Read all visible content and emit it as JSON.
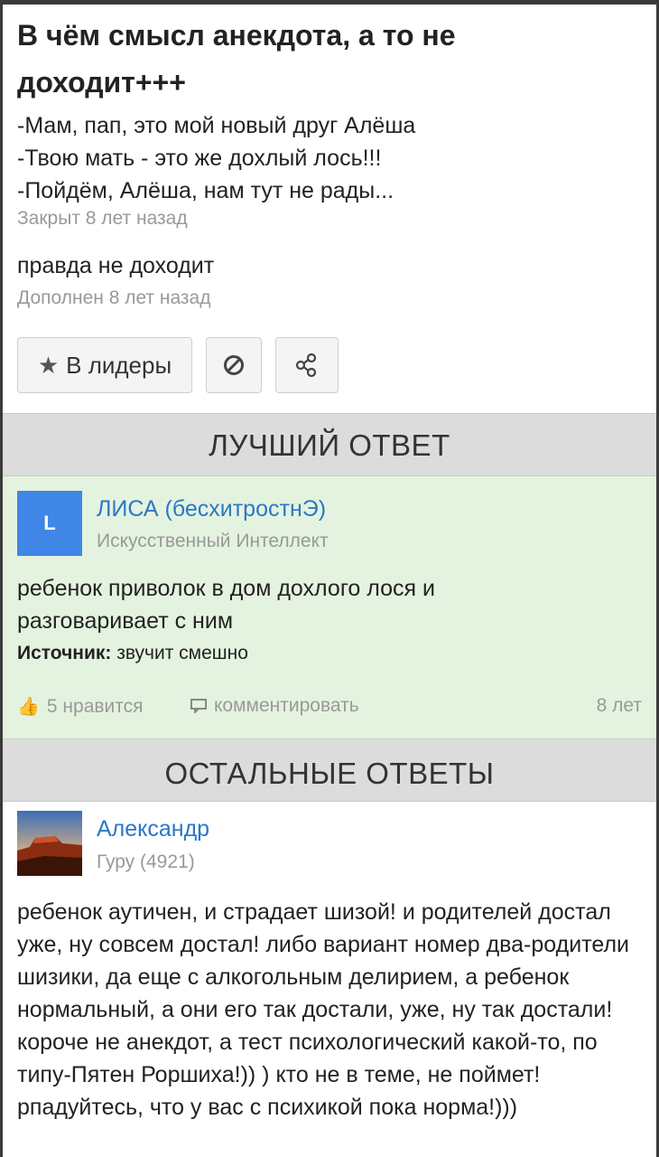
{
  "question": {
    "title": "В чём смысл анекдота, а то не доходит+++",
    "lines": [
      "-Мам, пап, это мой новый друг Алёша",
      "-Твою мать - это же дохлый лось!!!",
      "-Пойдём, Алёша, нам тут не рады..."
    ],
    "closed": "Закрыт 8 лет назад",
    "addendum": "правда не доходит",
    "added": "Дополнен 8 лет назад"
  },
  "buttons": {
    "leaders": "В лидеры",
    "leaders_icon": "star-icon",
    "report_icon": "block-icon",
    "share_icon": "share-icon"
  },
  "sections": {
    "best": "ЛУЧШИЙ ОТВЕТ",
    "other": "ОСТАЛЬНЫЕ ОТВЕТЫ"
  },
  "best_answer": {
    "avatar_letter": "L",
    "author": "ЛИСА (бесхитростнЭ)",
    "rank": "Искусственный Интеллект",
    "text": "ребенок приволок в дом дохлого лося и разговаривает с ним",
    "source_label": "Источник:",
    "source_text": "звучит смешно",
    "likes": "5 нравится",
    "comment": "комментировать",
    "age": "8 лет"
  },
  "other_answer": {
    "author": "Александр",
    "rank": "Гуру (4921)",
    "text": "ребенок аутичен, и страдает шизой! и родителей достал уже, ну совсем достал! либо вариант номер два-родители шизики, да еще с алкогольным делирием, а ребенок нормальный, а они его так достали, уже, ну так достали! короче не анекдот, а тест психологический какой-то, по типу-Пятен Роршиха!)) ) кто не в теме, не поймет! рпадуйтесь, что у вас с психикой пока норма!)))"
  },
  "colors": {
    "accent_link": "#2a78c8",
    "best_bg": "#e4f3df",
    "avatar_bg": "#3f86e6"
  }
}
